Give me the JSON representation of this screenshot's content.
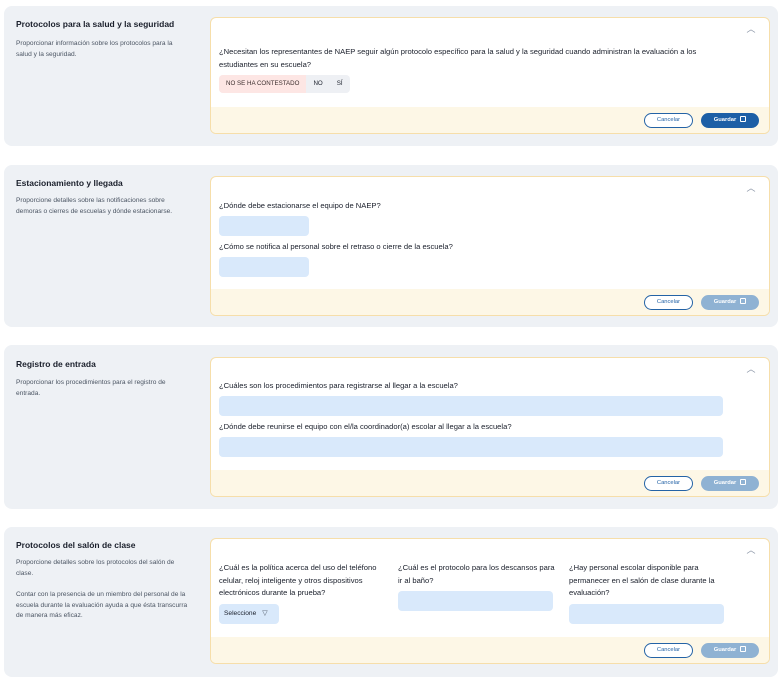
{
  "sections": [
    {
      "title": "Protocolos para la salud y la seguridad",
      "description": "Proporcionar información sobre los protocolos para la salud y la seguridad.",
      "question": "¿Necesitan los representantes de NAEP seguir algún protocolo específico para la salud y la seguridad cuando administran la evaluación a los estudiantes en su escuela?",
      "options": [
        "NO SE HA CONTESTADO",
        "NO",
        "SÍ"
      ],
      "selected_option": "NO SE HA CONTESTADO",
      "cancel_label": "Cancelar",
      "save_label": "Guardar"
    },
    {
      "title": "Estacionamiento y llegada",
      "description": "Proporcione detalles sobre las notificaciones sobre demoras o cierres de escuelas y dónde estacionarse.",
      "questions": [
        "¿Dónde debe estacionarse el equipo de NAEP?",
        "¿Cómo se notifica al personal sobre el retraso o cierre de la escuela?"
      ],
      "cancel_label": "Cancelar",
      "save_label": "Guardar"
    },
    {
      "title": "Registro de entrada",
      "description": "Proporcionar los procedimientos para el registro de entrada.",
      "questions": [
        "¿Cuáles son los procedimientos para registrarse al llegar a la escuela?",
        "¿Dónde debe reunirse el equipo con el/la coordinador(a) escolar al llegar a la escuela?"
      ],
      "cancel_label": "Cancelar",
      "save_label": "Guardar"
    },
    {
      "title": "Protocolos del salón de clase",
      "description": "Proporcione detalles sobre los protocolos del salón de clase.",
      "description2": "Contar con la presencia de un miembro del personal de la escuela durante la evaluación ayuda a que ésta transcurra de manera más eficaz.",
      "questions": [
        "¿Cuál es la política acerca del uso del teléfono celular, reloj inteligente y otros dispositivos electrónicos durante la prueba?",
        "¿Cuál es el protocolo para los descansos para ir al baño?",
        "¿Hay personal escolar disponible para permanecer en el salón de clase durante la evaluación?"
      ],
      "select_placeholder": "Seleccione",
      "cancel_label": "Cancelar",
      "save_label": "Guardar"
    }
  ],
  "icons": {
    "collapse": "chevron-up-icon",
    "save": "save-icon",
    "dropdown": "chevron-down-icon"
  },
  "colors": {
    "accent": "#1d5fa6",
    "panel_border": "#f6deaa",
    "footer_bg": "#fdf7e6",
    "field_bg": "#d9e9fb",
    "section_bg": "#eef1f5"
  }
}
